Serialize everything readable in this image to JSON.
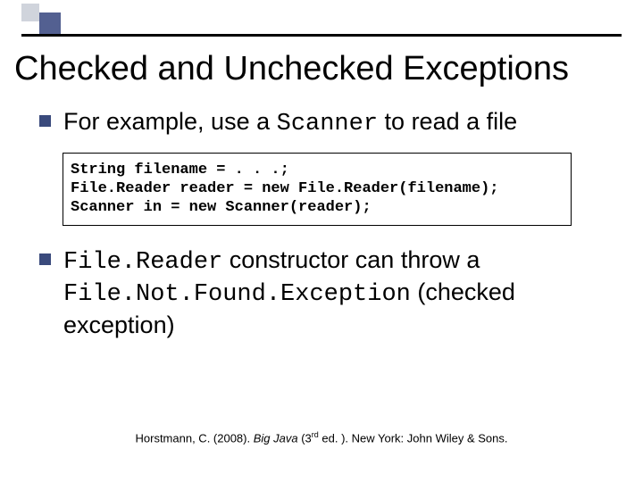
{
  "title": "Checked and Unchecked Exceptions",
  "bullet1": {
    "prefix": "For example, use a ",
    "code": "Scanner",
    "suffix": " to read a file"
  },
  "code": {
    "line1": "String filename = . . .;",
    "line2": "File.Reader reader = new File.Reader(filename);",
    "line3": "Scanner in = new Scanner(reader);"
  },
  "bullet2": {
    "code1": "File.Reader",
    "mid1": " constructor can throw a ",
    "code2": "File.Not.Found.Exception",
    "mid2": " (checked exception)"
  },
  "citation": {
    "author": "Horstmann, C. (2008). ",
    "title": "Big Java",
    "edition_open": " (3",
    "edition_sup": "rd",
    "edition_close": " ed. ). New York: John Wiley & Sons."
  }
}
